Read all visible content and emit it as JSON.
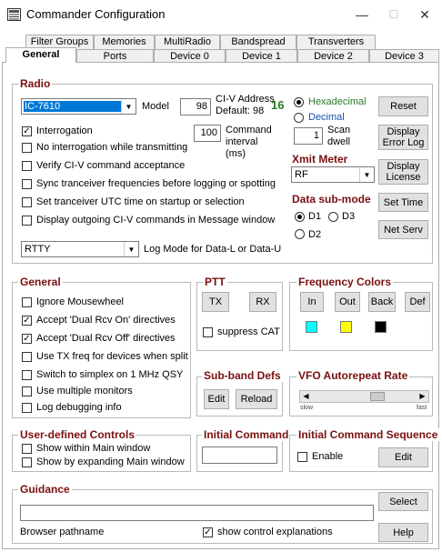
{
  "window": {
    "title": "Commander Configuration",
    "min": "—",
    "max": "☐",
    "close": "✕"
  },
  "tabs_row1": [
    "Filter Groups",
    "Memories",
    "MultiRadio",
    "Bandspread",
    "Transverters"
  ],
  "tabs_row2": [
    "General",
    "Ports",
    "Device 0",
    "Device 1",
    "Device 2",
    "Device 3"
  ],
  "radio": {
    "title": "Radio",
    "model_value": "IC-7610",
    "model_label": "Model",
    "civ_address_value": "98",
    "civ_address_label": "CI-V Address",
    "civ_default_label": "Default: 98",
    "civ_address_display": "16",
    "hex_label": "Hexadecimal",
    "decimal_label": "Decimal",
    "reset_label": "Reset",
    "interrogation_label": "Interrogation",
    "command_interval_value": "100",
    "command_interval_label": "Command interval (ms)",
    "scan_dwell_value": "1",
    "scan_dwell_label": "Scan dwell",
    "display_error_log_label": "Display Error Log",
    "no_interrogation_label": "No interrogation while transmitting",
    "verify_civ_label": "Verify CI-V command acceptance",
    "sync_label": "Sync tranceiver frequencies before logging or spotting",
    "set_utc_label": "Set tranceiver UTC time on startup or selection",
    "display_outgoing_label": "Display outgoing CI-V commands in Message window",
    "xmit_meter_title": "Xmit Meter",
    "xmit_meter_value": "RF",
    "display_license_label": "Display License",
    "data_submode_title": "Data sub-mode",
    "d1_label": "D1",
    "d2_label": "D2",
    "d3_label": "D3",
    "set_time_label": "Set Time",
    "net_serv_label": "Net Serv",
    "log_mode_value": "RTTY",
    "log_mode_label": "Log Mode for Data-L or Data-U"
  },
  "general": {
    "title": "General",
    "ignore_mousewheel": "Ignore Mousewheel",
    "accept_dual_on": "Accept 'Dual Rcv On' directives",
    "accept_dual_off": "Accept 'Dual Rcv Off' directives",
    "use_tx_freq": "Use TX freq for devices when split",
    "switch_simplex": "Switch to simplex on 1 MHz QSY",
    "use_multiple_monitors": "Use multiple monitors",
    "log_debugging": "Log debugging info"
  },
  "ptt": {
    "title": "PTT",
    "tx_label": "TX",
    "rx_label": "RX",
    "suppress_cat": "suppress CAT"
  },
  "freq_colors": {
    "title": "Frequency Colors",
    "in_label": "In",
    "out_label": "Out",
    "back_label": "Back",
    "def_label": "Def",
    "color_in": "#00ffff",
    "color_out": "#ffff00",
    "color_back": "#000000"
  },
  "subband": {
    "title": "Sub-band Defs",
    "edit_label": "Edit",
    "reload_label": "Reload"
  },
  "vfo": {
    "title": "VFO Autorepeat Rate",
    "slow": "slow",
    "fast": "fast",
    "value_fraction": 0.65
  },
  "user_controls": {
    "title": "User-defined Controls",
    "show_within": "Show within Main window",
    "show_expanding": "Show by expanding Main window"
  },
  "initial_command": {
    "title": "Initial Command",
    "value": ""
  },
  "initial_sequence": {
    "title": "Initial Command Sequence",
    "enable_label": "Enable",
    "edit_label": "Edit"
  },
  "guidance": {
    "title": "Guidance",
    "select_label": "Select",
    "path_value": "",
    "browser_label": "Browser pathname",
    "show_explanations": "show control explanations",
    "help_label": "Help"
  },
  "colors": {
    "accent_title": "#7a0f0f",
    "selection": "#0078d7",
    "hex_digits": "#2a7a2a"
  }
}
